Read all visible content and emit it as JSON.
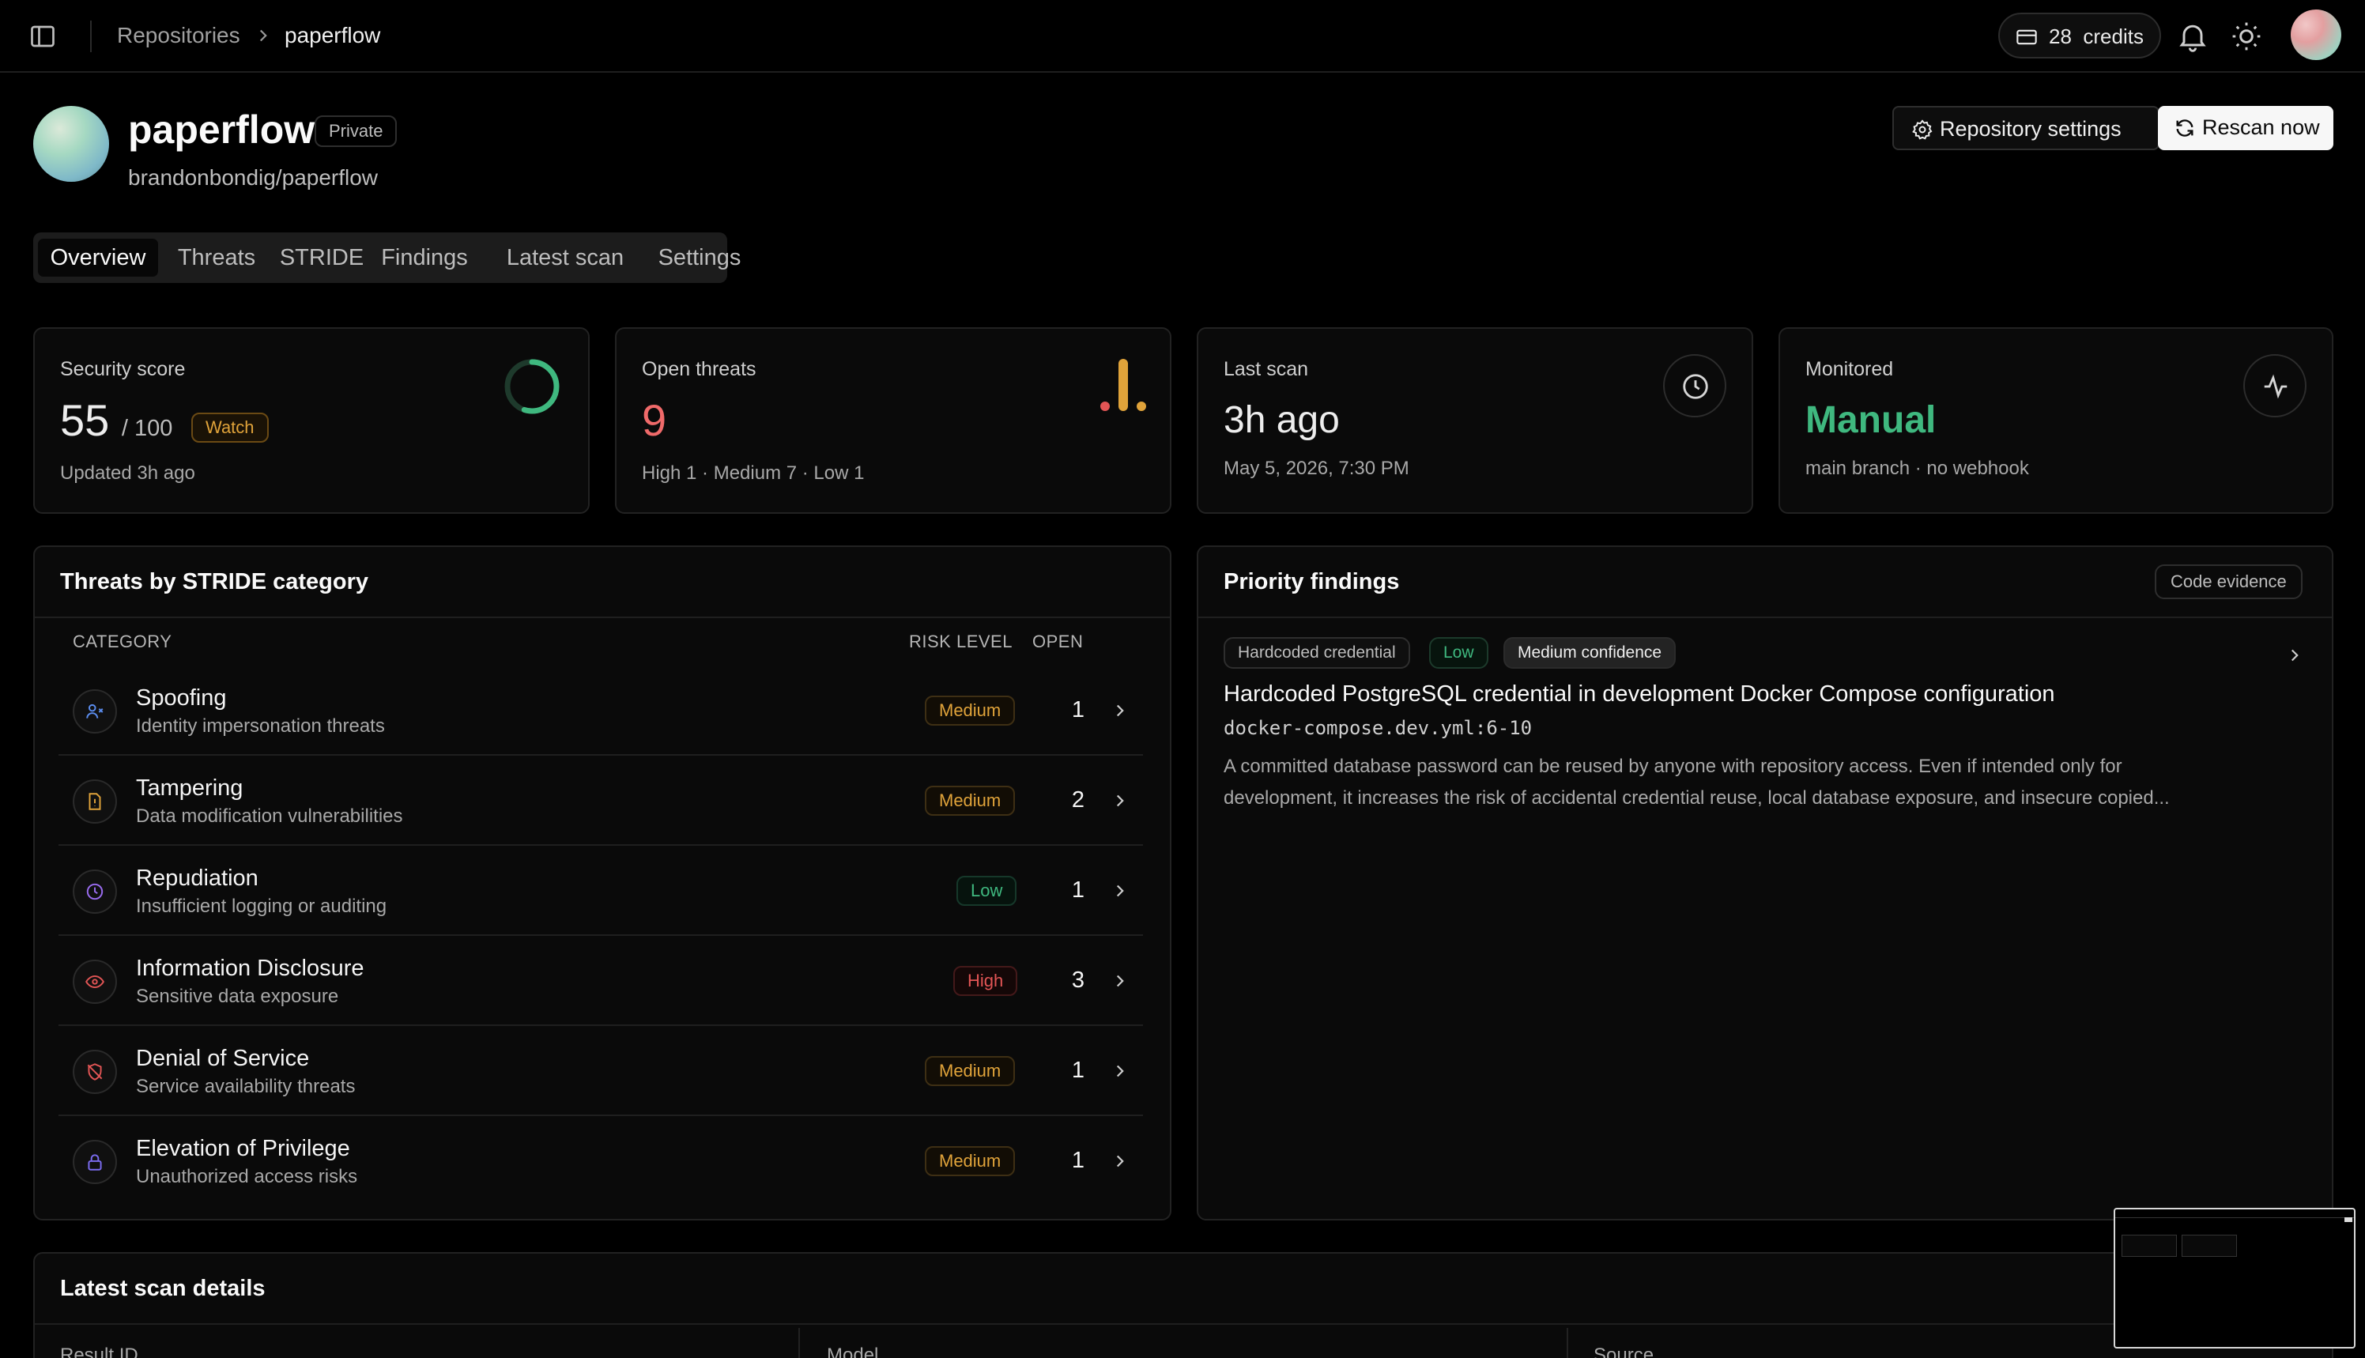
{
  "header": {
    "breadcrumb_root": "Repositories",
    "breadcrumb_current": "paperflow",
    "credits_label": "28  credits"
  },
  "repo": {
    "name": "paperflow",
    "visibility": "Private",
    "path": "brandonbondig/paperflow",
    "settings_button": "Repository settings",
    "rescan_button": "Rescan now"
  },
  "tabs": [
    "Overview",
    "Threats",
    "STRIDE",
    "Findings",
    "Latest scan",
    "Settings"
  ],
  "stats": {
    "score": {
      "label": "Security score",
      "value": "55",
      "max": "/ 100",
      "badge": "Watch",
      "sub": "Updated 3h ago",
      "fraction": 0.55
    },
    "threats": {
      "label": "Open threats",
      "value": "9",
      "sub": "High 1 · Medium 7 · Low 1",
      "high": 1,
      "medium": 7,
      "low": 1
    },
    "last_scan": {
      "label": "Last scan",
      "value": "3h ago",
      "sub": "May 5, 2026, 7:30 PM"
    },
    "monitored": {
      "label": "Monitored",
      "value": "Manual",
      "sub": "main branch · no webhook"
    }
  },
  "stride": {
    "title": "Threats by STRIDE category",
    "headers": {
      "category": "CATEGORY",
      "risk": "RISK LEVEL",
      "open": "OPEN"
    },
    "rows": [
      {
        "name": "Spoofing",
        "desc": "Identity impersonation threats",
        "risk": "Medium",
        "count": "1",
        "icon": "user-x-icon",
        "color": "#5b8def"
      },
      {
        "name": "Tampering",
        "desc": "Data modification vulnerabilities",
        "risk": "Medium",
        "count": "2",
        "icon": "file-warning-icon",
        "color": "#e0a33a"
      },
      {
        "name": "Repudiation",
        "desc": "Insufficient logging or auditing",
        "risk": "Low",
        "count": "1",
        "icon": "clock-icon",
        "color": "#9a6cf0"
      },
      {
        "name": "Information Disclosure",
        "desc": "Sensitive data exposure",
        "risk": "High",
        "count": "3",
        "icon": "eye-icon",
        "color": "#e25555"
      },
      {
        "name": "Denial of Service",
        "desc": "Service availability threats",
        "risk": "Medium",
        "count": "1",
        "icon": "shield-off-icon",
        "color": "#e25555"
      },
      {
        "name": "Elevation of Privilege",
        "desc": "Unauthorized access risks",
        "risk": "Medium",
        "count": "1",
        "icon": "lock-icon",
        "color": "#7b6cf0"
      }
    ]
  },
  "priority": {
    "title": "Priority findings",
    "code_evidence": "Code evidence",
    "finding": {
      "tag": "Hardcoded credential",
      "severity": "Low",
      "confidence": "Medium confidence",
      "title": "Hardcoded PostgreSQL credential in development Docker Compose configuration",
      "file": "docker-compose.dev.yml:6-10",
      "description_line1": "A committed database password can be reused by anyone with repository access. Even if intended only for",
      "description_line2": "development, it increases the risk of accidental credential reuse, local database exposure, and insecure copied..."
    }
  },
  "scan_details": {
    "title": "Latest scan details",
    "columns": [
      "Result ID",
      "Model",
      "Source"
    ]
  },
  "colors": {
    "accent_green": "#3fb87f",
    "danger": "#e25555",
    "warning": "#e0a33a"
  }
}
